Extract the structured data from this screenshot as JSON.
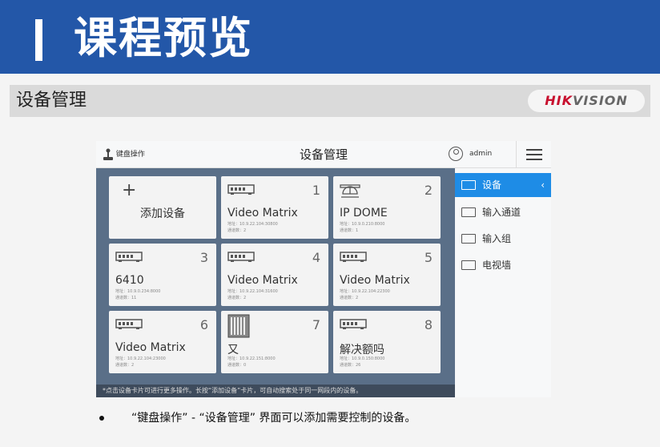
{
  "banner": {
    "title": "课程预览"
  },
  "section": {
    "label": "设备管理",
    "logo_hik": "HIK",
    "logo_vision": "VISION"
  },
  "app": {
    "keyboard_label": "键盘操作",
    "title": "设备管理",
    "user": "admin",
    "add_card": {
      "label": "添加设备"
    },
    "cards": [
      {
        "num": "1",
        "name": "Video Matrix",
        "addr": "地址：10.9.22.104:30800",
        "channels": "通道数：2",
        "icon": "matrix-device-icon"
      },
      {
        "num": "2",
        "name": "IP DOME",
        "addr": "地址：10.9.0.210:8000",
        "channels": "通道数：1",
        "icon": "dome-camera-icon"
      },
      {
        "num": "3",
        "name": "6410",
        "addr": "地址：10.9.0.234:8000",
        "channels": "通道数：11",
        "icon": "matrix-device-icon"
      },
      {
        "num": "4",
        "name": "Video Matrix",
        "addr": "地址：10.9.22.104:31600",
        "channels": "通道数：2",
        "icon": "matrix-device-icon"
      },
      {
        "num": "5",
        "name": "Video Matrix",
        "addr": "地址：10.9.22.104:22300",
        "channels": "通道数：2",
        "icon": "matrix-device-icon"
      },
      {
        "num": "6",
        "name": "Video Matrix",
        "addr": "地址：10.9.22.104:23000",
        "channels": "通道数：2",
        "icon": "matrix-device-icon"
      },
      {
        "num": "7",
        "name": "又",
        "addr": "地址：10.9.22.151:8000",
        "channels": "通道数：0",
        "icon": "rack-device-icon"
      },
      {
        "num": "8",
        "name": "解决额吗",
        "addr": "地址：10.9.0.150:8000",
        "channels": "通道数：26",
        "icon": "matrix-device-icon"
      }
    ],
    "note": "*点击设备卡片可进行更多操作。长按“添加设备”卡片，可自动搜索处于同一网段内的设备。",
    "sidebar": [
      {
        "label": "设备",
        "icon": "device-icon",
        "active": true
      },
      {
        "label": "输入通道",
        "icon": "camera-icon",
        "active": false
      },
      {
        "label": "输入组",
        "icon": "folder-icon",
        "active": false
      },
      {
        "label": "电视墙",
        "icon": "tv-wall-icon",
        "active": false
      }
    ]
  },
  "bullet": {
    "text": "“键盘操作” - “设备管理” 界面可以添加需要控制的设备。"
  },
  "colors": {
    "banner": "#2357a8",
    "active": "#1e8ce6",
    "logo_red": "#c8102e"
  }
}
